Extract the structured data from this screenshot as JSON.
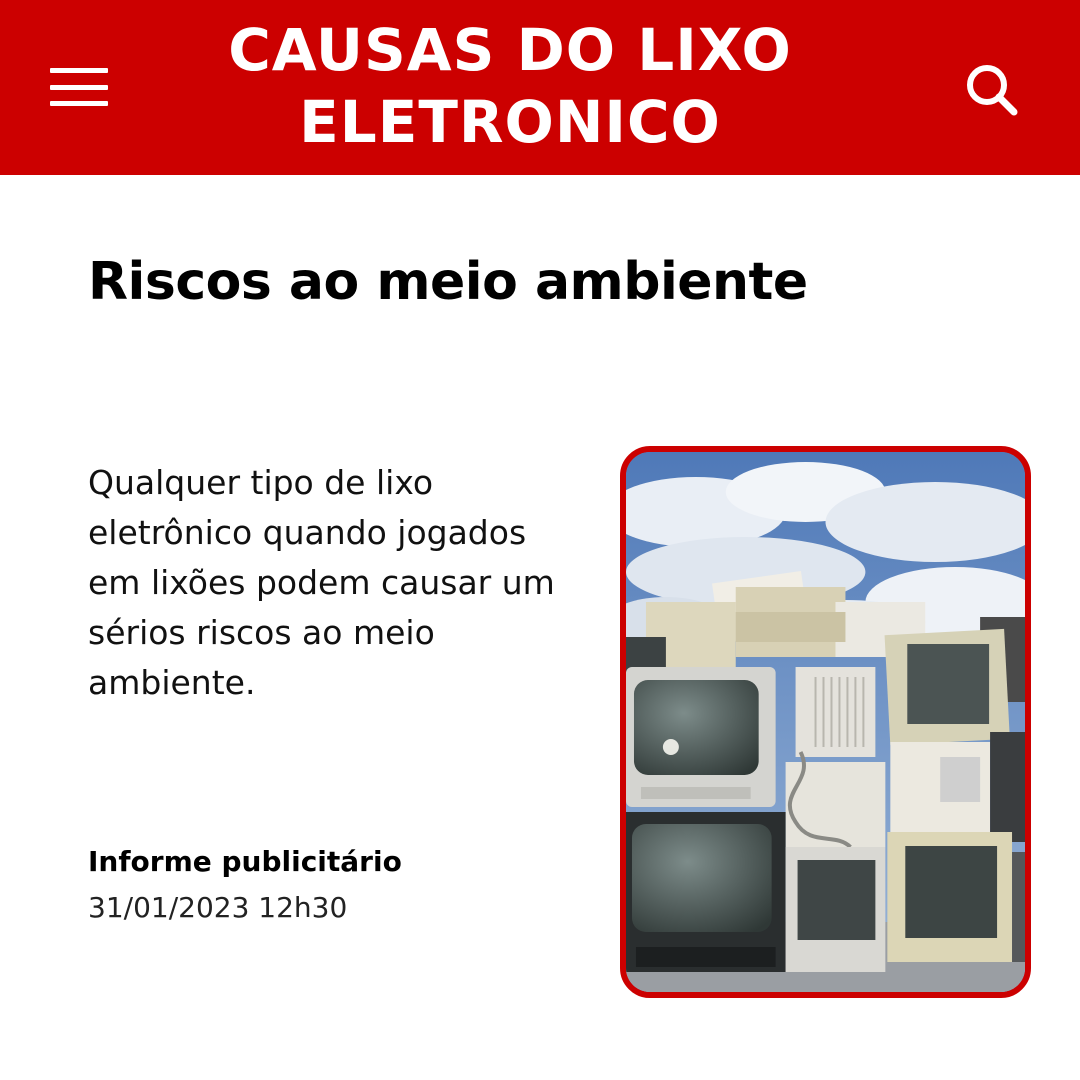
{
  "header": {
    "title": "CAUSAS DO LIXO ELETRONICO",
    "menu_icon": "hamburger-menu-icon",
    "search_icon": "search-icon",
    "background_color": "#cc0000"
  },
  "article": {
    "title": "Riscos ao meio ambiente",
    "body": "Qualquer tipo de lixo eletrônico quando jogados em lixões podem causar um sérios riscos ao meio ambiente.",
    "byline": "Informe publicitário",
    "datetime": "31/01/2023 12h30",
    "image_border_color": "#cc0000"
  }
}
